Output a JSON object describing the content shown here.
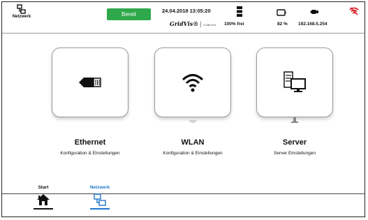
{
  "statusbar": {
    "network_label": "Netzwerk",
    "status": "Bereit",
    "status_color": "#2ea84a",
    "datetime": "24.04.2018 13:05:20",
    "brand": "GridVis",
    "brand_suffix": "Collector",
    "memory": "100% frei",
    "battery": "82 %",
    "ip": "192.168.5.254",
    "icons": [
      "network-icon",
      "memory-icon",
      "battery-icon",
      "ethernet-icon",
      "wifi-icon"
    ],
    "wifi_icon_color": "#d6262b"
  },
  "tiles": [
    {
      "title": "Ethernet",
      "description": "Konfiguration & Einstellungen",
      "icon": "ethernet-plug-icon"
    },
    {
      "title": "WLAN",
      "description": "Konfiguration & Einstellungen",
      "icon": "wifi-icon"
    },
    {
      "title": "Server",
      "description": "Server Einstellungen",
      "icon": "server-icon"
    }
  ],
  "nav": {
    "items": [
      {
        "label": "Start",
        "icon": "home-icon",
        "active": false
      },
      {
        "label": "Netzwerk",
        "icon": "network-icon",
        "active": true
      }
    ],
    "active_color": "#1f77d0"
  }
}
